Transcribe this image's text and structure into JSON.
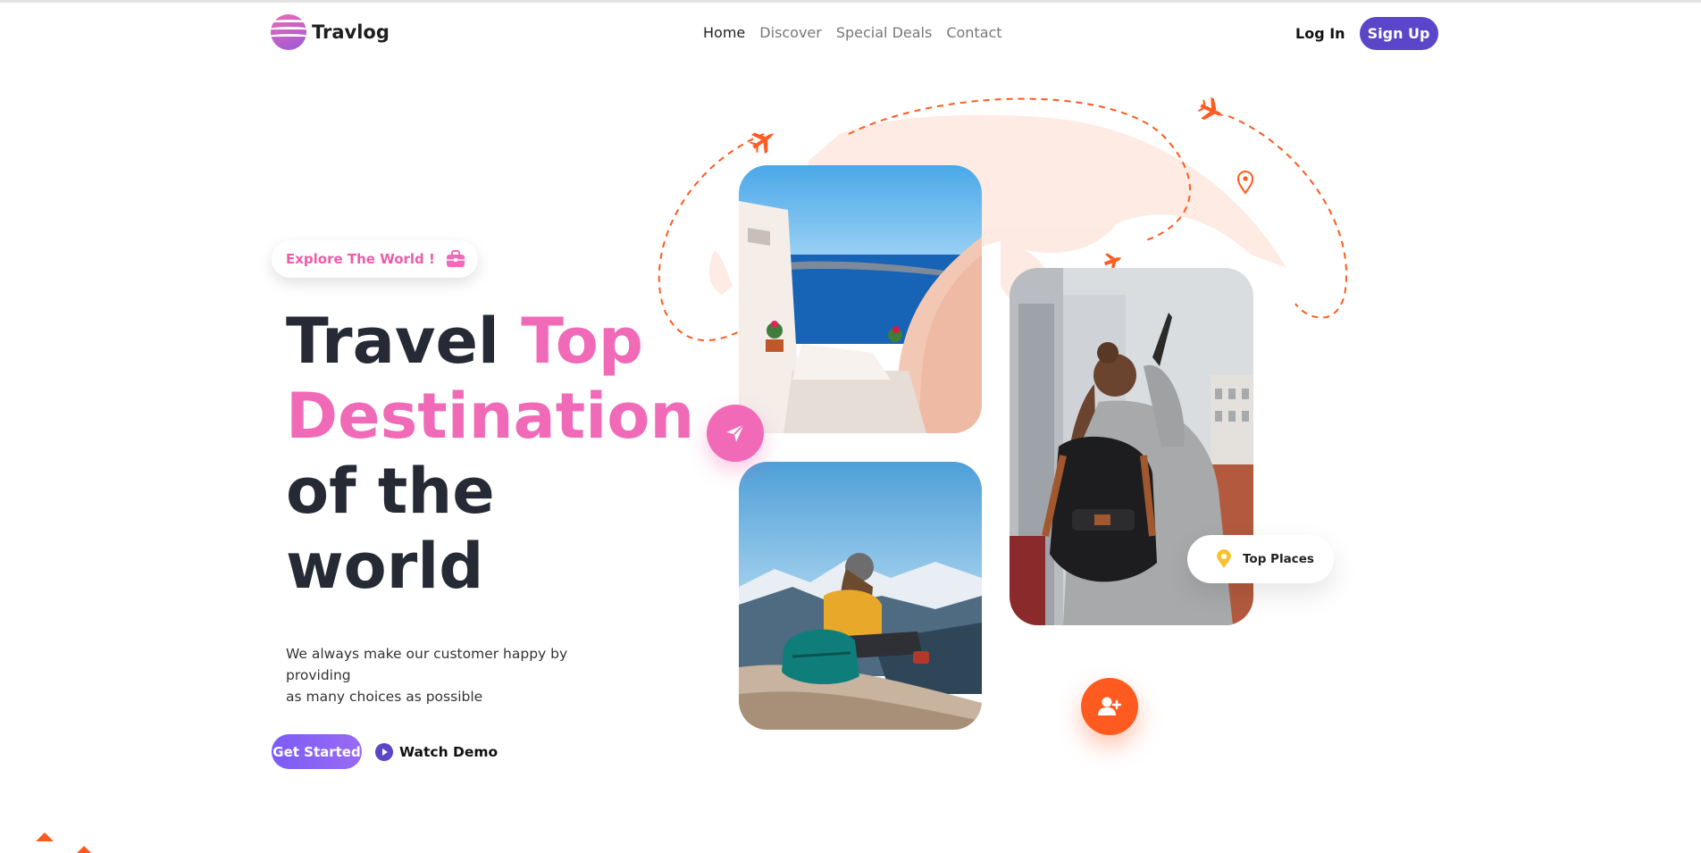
{
  "brand": {
    "name": "Travlog"
  },
  "nav": {
    "items": [
      {
        "label": "Home",
        "active": true
      },
      {
        "label": "Discover",
        "active": false
      },
      {
        "label": "Special Deals",
        "active": false
      },
      {
        "label": "Contact",
        "active": false
      }
    ]
  },
  "auth": {
    "login_label": "Log In",
    "signup_label": "Sign Up"
  },
  "hero": {
    "badge": "Explore The World !",
    "headline": {
      "part1": "Travel ",
      "part2": "Top",
      "part3": "Destination",
      "part4": "of the",
      "part5": "world"
    },
    "subtitle": {
      "line1": "We always make our customer happy by",
      "line2": "providing",
      "line3": "as many choices as possible"
    },
    "cta_primary": "Get Started",
    "cta_secondary": "Watch Demo",
    "top_places_label": "Top Places"
  },
  "colors": {
    "accent_purple": "#5b45c8",
    "accent_pink": "#f06ab8",
    "accent_orange": "#ff5a1f",
    "text_dark": "#252a35"
  },
  "icons": [
    "logo-icon",
    "briefcase-icon",
    "send-icon",
    "user-plus-icon",
    "location-pin-icon",
    "airplane-icon",
    "play-icon"
  ]
}
